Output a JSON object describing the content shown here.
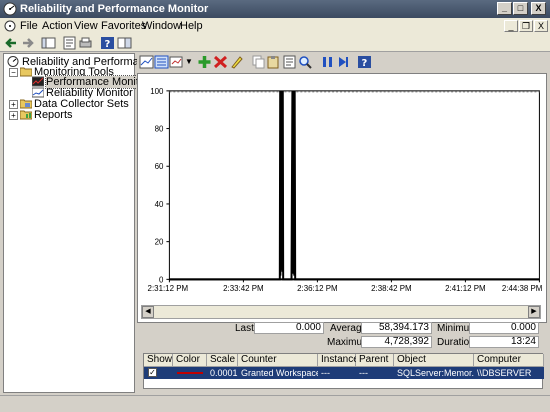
{
  "window": {
    "title": "Reliability and Performance Monitor"
  },
  "menu": {
    "items": [
      "File",
      "Action",
      "View",
      "Favorites",
      "Window",
      "Help"
    ]
  },
  "tree": {
    "root": "Reliability and Performance",
    "monitoring": "Monitoring Tools",
    "perfmon": "Performance Monitor",
    "relmon": "Reliability Monitor",
    "dcs": "Data Collector Sets",
    "reports": "Reports"
  },
  "chart_data": {
    "type": "line",
    "ylim": [
      0,
      100
    ],
    "yticks": [
      "100",
      "80",
      "60",
      "40",
      "20",
      "0"
    ],
    "xtick_labels": [
      "2:31:12 PM",
      "2:33:42 PM",
      "2:36:12 PM",
      "2:38:42 PM",
      "2:41:12 PM",
      "2:44:38 PM"
    ],
    "series": [
      {
        "x": [
          0,
          0.2985,
          0.2995,
          0.3,
          0.3005,
          0.3015,
          0.3025,
          0.3035,
          0.3045,
          0.3055,
          0.3065,
          0.3075,
          0.33,
          0.3325,
          0.3335,
          0.3345,
          0.3355,
          0.3365,
          0.3375,
          0.3385,
          0.34,
          0.3415,
          1
        ],
        "y": [
          0,
          0,
          100,
          2,
          100,
          5,
          100,
          8,
          100,
          4,
          100,
          0,
          0,
          100,
          3,
          100,
          6,
          100,
          2,
          100,
          0,
          0,
          0
        ]
      }
    ]
  },
  "stats": {
    "last_label": "Last",
    "last": "0.000",
    "average_label": "Average",
    "average": "58,394.173",
    "minimum_label": "Minimum",
    "minimum": "0.000",
    "maximum_label": "Maximum",
    "maximum": "4,728,392",
    "duration_label": "Duration",
    "duration": "13:24"
  },
  "table": {
    "headers": [
      "Show",
      "Color",
      "Scale",
      "Counter",
      "Instance",
      "Parent",
      "Object",
      "Computer"
    ],
    "row": {
      "scale": "0.0001",
      "counter": "Granted Workspace...",
      "instance": "---",
      "parent": "---",
      "object": "SQLServer:Memor...",
      "computer": "\\\\DBSERVER"
    }
  },
  "colors": {
    "line": "#000000",
    "row_select": "#1e3c78",
    "color_swatch": "#c00000"
  }
}
